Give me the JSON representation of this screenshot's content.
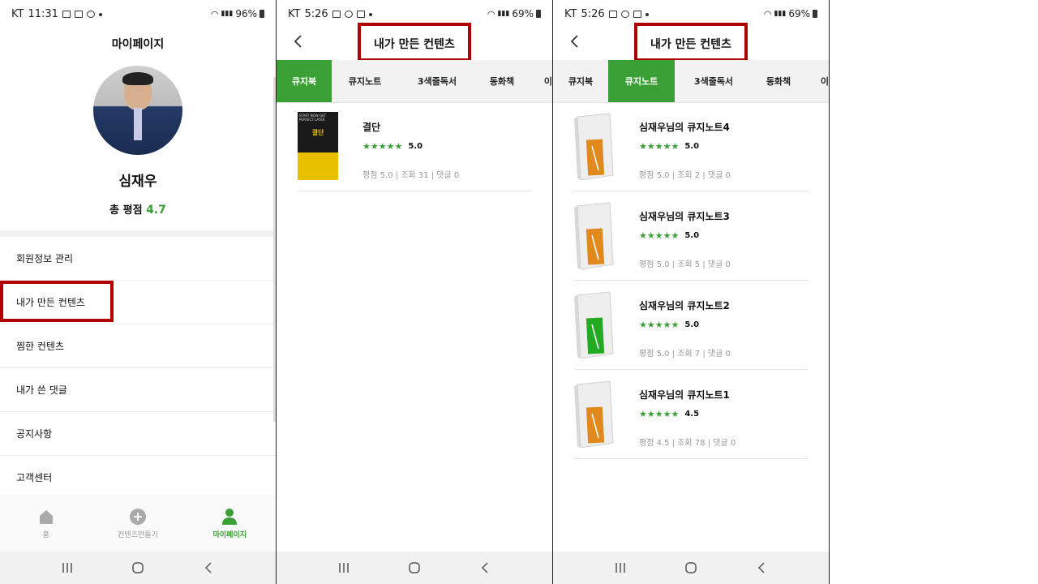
{
  "colors": {
    "accent": "#3aa035",
    "highlight": "#b00000"
  },
  "screen1": {
    "status": {
      "carrier": "KT",
      "time": "11:31",
      "battery": "96%"
    },
    "header_title": "마이페이지",
    "profile": {
      "name": "심재우",
      "rating_label": "총 평점",
      "rating_value": "4.7"
    },
    "menu": [
      "회원정보 관리",
      "내가 만든 컨텐츠",
      "찜한 컨텐츠",
      "내가 쓴 댓글",
      "공지사항",
      "고객센터"
    ],
    "bottom_nav": [
      {
        "label": "홈",
        "icon": "home-icon"
      },
      {
        "label": "컨텐츠만들기",
        "icon": "plus-circle-icon"
      },
      {
        "label": "마이페이지",
        "icon": "person-icon"
      }
    ]
  },
  "screen2": {
    "status": {
      "carrier": "KT",
      "time": "5:26",
      "battery": "69%"
    },
    "header_title": "내가 만든 컨텐츠",
    "tabs": [
      "큐지북",
      "큐지노트",
      "3색줄독서",
      "동화책",
      "이"
    ],
    "active_tab": "큐지북",
    "items": [
      {
        "title": "결단",
        "rating": "5.0",
        "meta": "평점 5.0 | 조회 31 | 댓글 0",
        "cover_title": "결단"
      }
    ]
  },
  "screen3": {
    "status": {
      "carrier": "KT",
      "time": "5:26",
      "battery": "69%"
    },
    "header_title": "내가 만든 컨텐츠",
    "tabs": [
      "큐지북",
      "큐지노트",
      "3색줄독서",
      "동화책",
      "이"
    ],
    "active_tab": "큐지노트",
    "items": [
      {
        "title": "심재우님의 큐지노트4",
        "rating": "5.0",
        "meta": "평점 5.0 | 조회 2 | 댓글 0",
        "note_color": "#e08a1e"
      },
      {
        "title": "심재우님의 큐지노트3",
        "rating": "5.0",
        "meta": "평점 5.0 | 조회 5 | 댓글 0",
        "note_color": "#e08a1e"
      },
      {
        "title": "심재우님의 큐지노트2",
        "rating": "5.0",
        "meta": "평점 5.0 | 조회 7 | 댓글 0",
        "note_color": "#22aa22"
      },
      {
        "title": "심재우님의 큐지노트1",
        "rating": "4.5",
        "meta": "평점 4.5 | 조회 78 | 댓글 0",
        "note_color": "#e08a1e"
      }
    ]
  }
}
